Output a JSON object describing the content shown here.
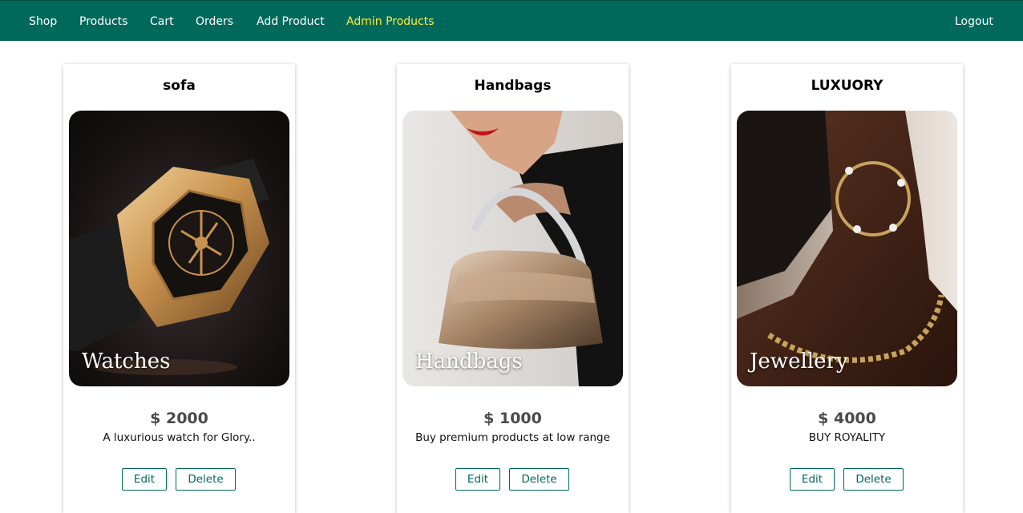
{
  "nav": {
    "items": [
      {
        "label": "Shop"
      },
      {
        "label": "Products"
      },
      {
        "label": "Cart"
      },
      {
        "label": "Orders"
      },
      {
        "label": "Add Product"
      },
      {
        "label": "Admin Products",
        "active": true
      }
    ],
    "logout_label": "Logout",
    "colors": {
      "background": "#00695c",
      "text": "#ffffff",
      "active": "#ffeb3b"
    }
  },
  "products": [
    {
      "title": "sofa",
      "image_caption": "Watches",
      "image_icon": "gold-watch-image",
      "price": "$ 2000",
      "description": "A luxurious watch for Glory..",
      "edit_label": "Edit",
      "delete_label": "Delete"
    },
    {
      "title": "Handbags",
      "image_caption": "Handbags",
      "image_icon": "handbag-image",
      "price": "$ 1000",
      "description": "Buy premium products at low range",
      "edit_label": "Edit",
      "delete_label": "Delete"
    },
    {
      "title": "LUXUORY",
      "image_caption": "Jewellery",
      "image_icon": "jewellery-image",
      "price": "$ 4000",
      "description": "BUY ROYALITY",
      "edit_label": "Edit",
      "delete_label": "Delete"
    }
  ],
  "colors": {
    "accent": "#00695c",
    "price_text": "#4a4a4a"
  }
}
